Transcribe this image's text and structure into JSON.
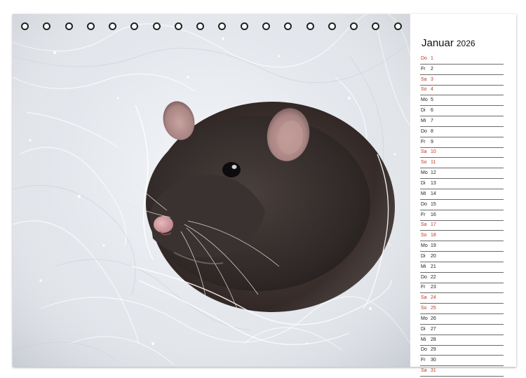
{
  "calendar": {
    "month": "Januar",
    "year": "2026",
    "days": [
      {
        "wd": "Do",
        "n": "1",
        "we": true
      },
      {
        "wd": "Fr",
        "n": "2",
        "we": false
      },
      {
        "wd": "Sa",
        "n": "3",
        "we": true
      },
      {
        "wd": "So",
        "n": "4",
        "we": true
      },
      {
        "wd": "Mo",
        "n": "5",
        "we": false
      },
      {
        "wd": "Di",
        "n": "6",
        "we": false
      },
      {
        "wd": "Mi",
        "n": "7",
        "we": false
      },
      {
        "wd": "Do",
        "n": "8",
        "we": false
      },
      {
        "wd": "Fr",
        "n": "9",
        "we": false
      },
      {
        "wd": "Sa",
        "n": "10",
        "we": true
      },
      {
        "wd": "So",
        "n": "11",
        "we": true
      },
      {
        "wd": "Mo",
        "n": "12",
        "we": false
      },
      {
        "wd": "Di",
        "n": "13",
        "we": false
      },
      {
        "wd": "Mi",
        "n": "14",
        "we": false
      },
      {
        "wd": "Do",
        "n": "15",
        "we": false
      },
      {
        "wd": "Fr",
        "n": "16",
        "we": false
      },
      {
        "wd": "Sa",
        "n": "17",
        "we": true
      },
      {
        "wd": "So",
        "n": "18",
        "we": true
      },
      {
        "wd": "Mo",
        "n": "19",
        "we": false
      },
      {
        "wd": "Di",
        "n": "20",
        "we": false
      },
      {
        "wd": "Mi",
        "n": "21",
        "we": false
      },
      {
        "wd": "Do",
        "n": "22",
        "we": false
      },
      {
        "wd": "Fr",
        "n": "23",
        "we": false
      },
      {
        "wd": "Sa",
        "n": "24",
        "we": true
      },
      {
        "wd": "So",
        "n": "25",
        "we": true
      },
      {
        "wd": "Mo",
        "n": "26",
        "we": false
      },
      {
        "wd": "Di",
        "n": "27",
        "we": false
      },
      {
        "wd": "Mi",
        "n": "28",
        "we": false
      },
      {
        "wd": "Do",
        "n": "29",
        "we": false
      },
      {
        "wd": "Fr",
        "n": "30",
        "we": false
      },
      {
        "wd": "Sa",
        "n": "31",
        "we": true
      }
    ]
  },
  "binding": {
    "ring_count": 23
  },
  "colors": {
    "weekend": "#c0392b",
    "text": "#222222",
    "rule": "#6b6b6b"
  }
}
